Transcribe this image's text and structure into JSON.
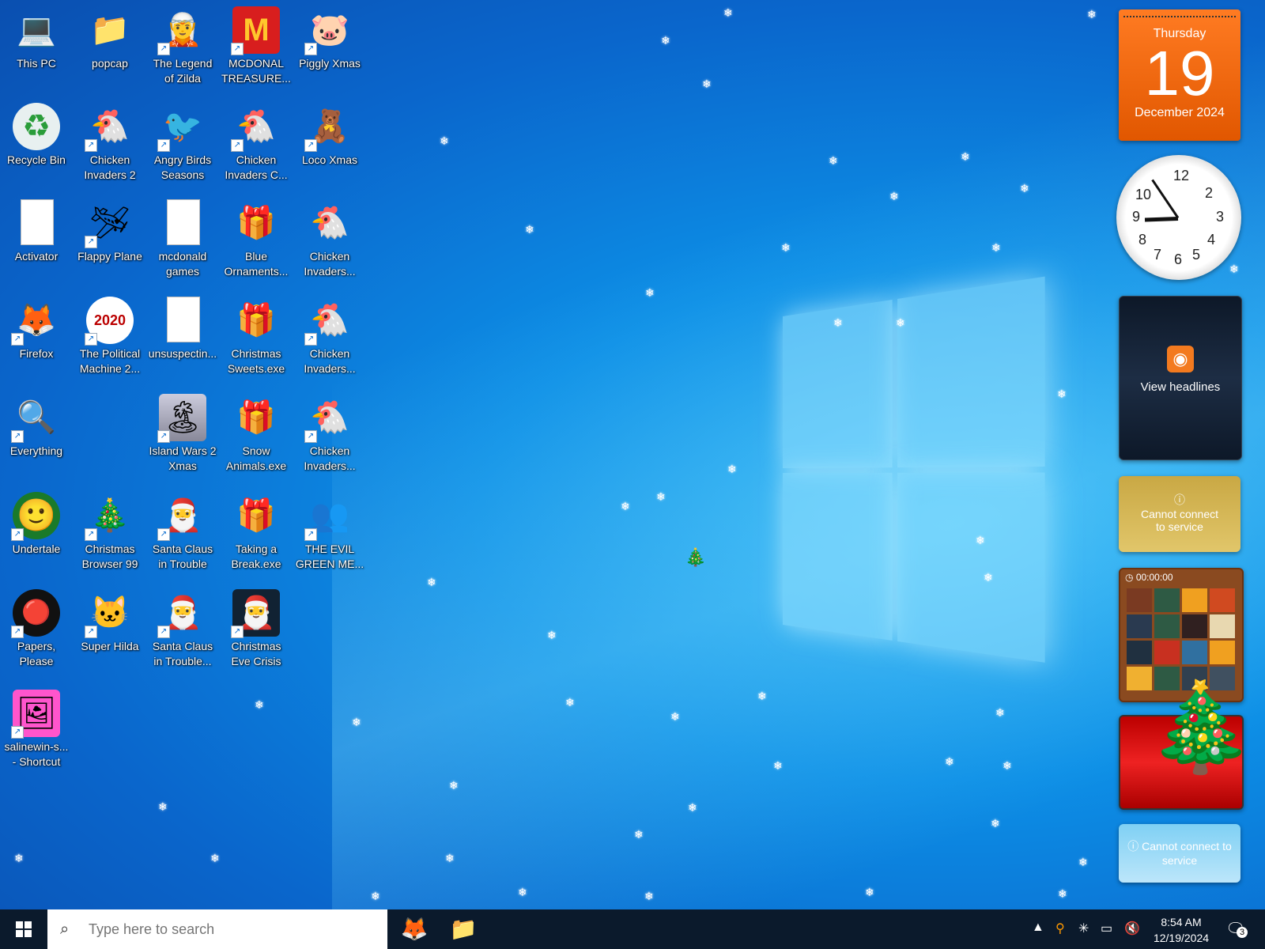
{
  "desktop_icons": [
    {
      "label": "This PC",
      "glyph": "💻"
    },
    {
      "label": "popcap",
      "glyph": "📁"
    },
    {
      "label": "The Legend of Zilda",
      "glyph": "🧝"
    },
    {
      "label": "MCDONAL TREASURE...",
      "glyph": "🍟"
    },
    {
      "label": "Piggly Xmas",
      "glyph": "🐷"
    },
    {
      "label": "Recycle Bin",
      "glyph": "♻"
    },
    {
      "label": "Chicken Invaders 2",
      "glyph": "🐔"
    },
    {
      "label": "Angry Birds Seasons",
      "glyph": "🐦"
    },
    {
      "label": "Chicken Invaders C...",
      "glyph": "🐔"
    },
    {
      "label": "Loco Xmas",
      "glyph": "🧸"
    },
    {
      "label": "Activator",
      "glyph": "📄"
    },
    {
      "label": "Flappy Plane",
      "glyph": "🛩"
    },
    {
      "label": "mcdonald games",
      "glyph": "📄"
    },
    {
      "label": "Blue Ornaments...",
      "glyph": "🎁"
    },
    {
      "label": "Chicken Invaders...",
      "glyph": "🐔"
    },
    {
      "label": "Firefox",
      "glyph": "🦊"
    },
    {
      "label": "The Political Machine 2...",
      "glyph": "🏛"
    },
    {
      "label": "unsuspectin...",
      "glyph": "📄"
    },
    {
      "label": "Christmas Sweets.exe",
      "glyph": "🎁"
    },
    {
      "label": "Chicken Invaders...",
      "glyph": "🐔"
    },
    {
      "label": "Everything",
      "glyph": "🔍"
    },
    {
      "label": "Island Wars 2 Xmas",
      "glyph": "🏝"
    },
    {
      "label": "Snow Animals.exe",
      "glyph": "🎁"
    },
    {
      "label": "Chicken Invaders...",
      "glyph": "🐔"
    },
    {
      "label": "Undertale",
      "glyph": "🙂"
    },
    {
      "label": "Christmas Browser 99",
      "glyph": "🎄"
    },
    {
      "label": "Santa Claus in Trouble",
      "glyph": "🎅"
    },
    {
      "label": "Taking a Break.exe",
      "glyph": "🎁"
    },
    {
      "label": "THE EVIL GREEN ME...",
      "glyph": "👥"
    },
    {
      "label": "Papers, Please",
      "glyph": "🔴"
    },
    {
      "label": "Super Hilda",
      "glyph": "🐱"
    },
    {
      "label": "Santa Claus in Trouble...",
      "glyph": "🎅"
    },
    {
      "label": "Christmas Eve Crisis",
      "glyph": "🎅"
    },
    {
      "label": "salinewin-s... - Shortcut",
      "glyph": "🖼"
    }
  ],
  "calendar": {
    "weekday": "Thursday",
    "day": "19",
    "month_year": "December 2024"
  },
  "clock": {
    "hour": 8,
    "minute": 54
  },
  "news_gadget": {
    "label": "View headlines",
    "icon": "rss-icon"
  },
  "weather_gadget": {
    "message": "Cannot connect to service"
  },
  "puzzle_gadget": {
    "timer": "00:00:00"
  },
  "feed_gadget": {
    "message": "Cannot connect to service"
  },
  "taskbar": {
    "search_placeholder": "Type here to search",
    "time": "8:54 AM",
    "date": "12/19/2024",
    "notification_count": "3"
  }
}
